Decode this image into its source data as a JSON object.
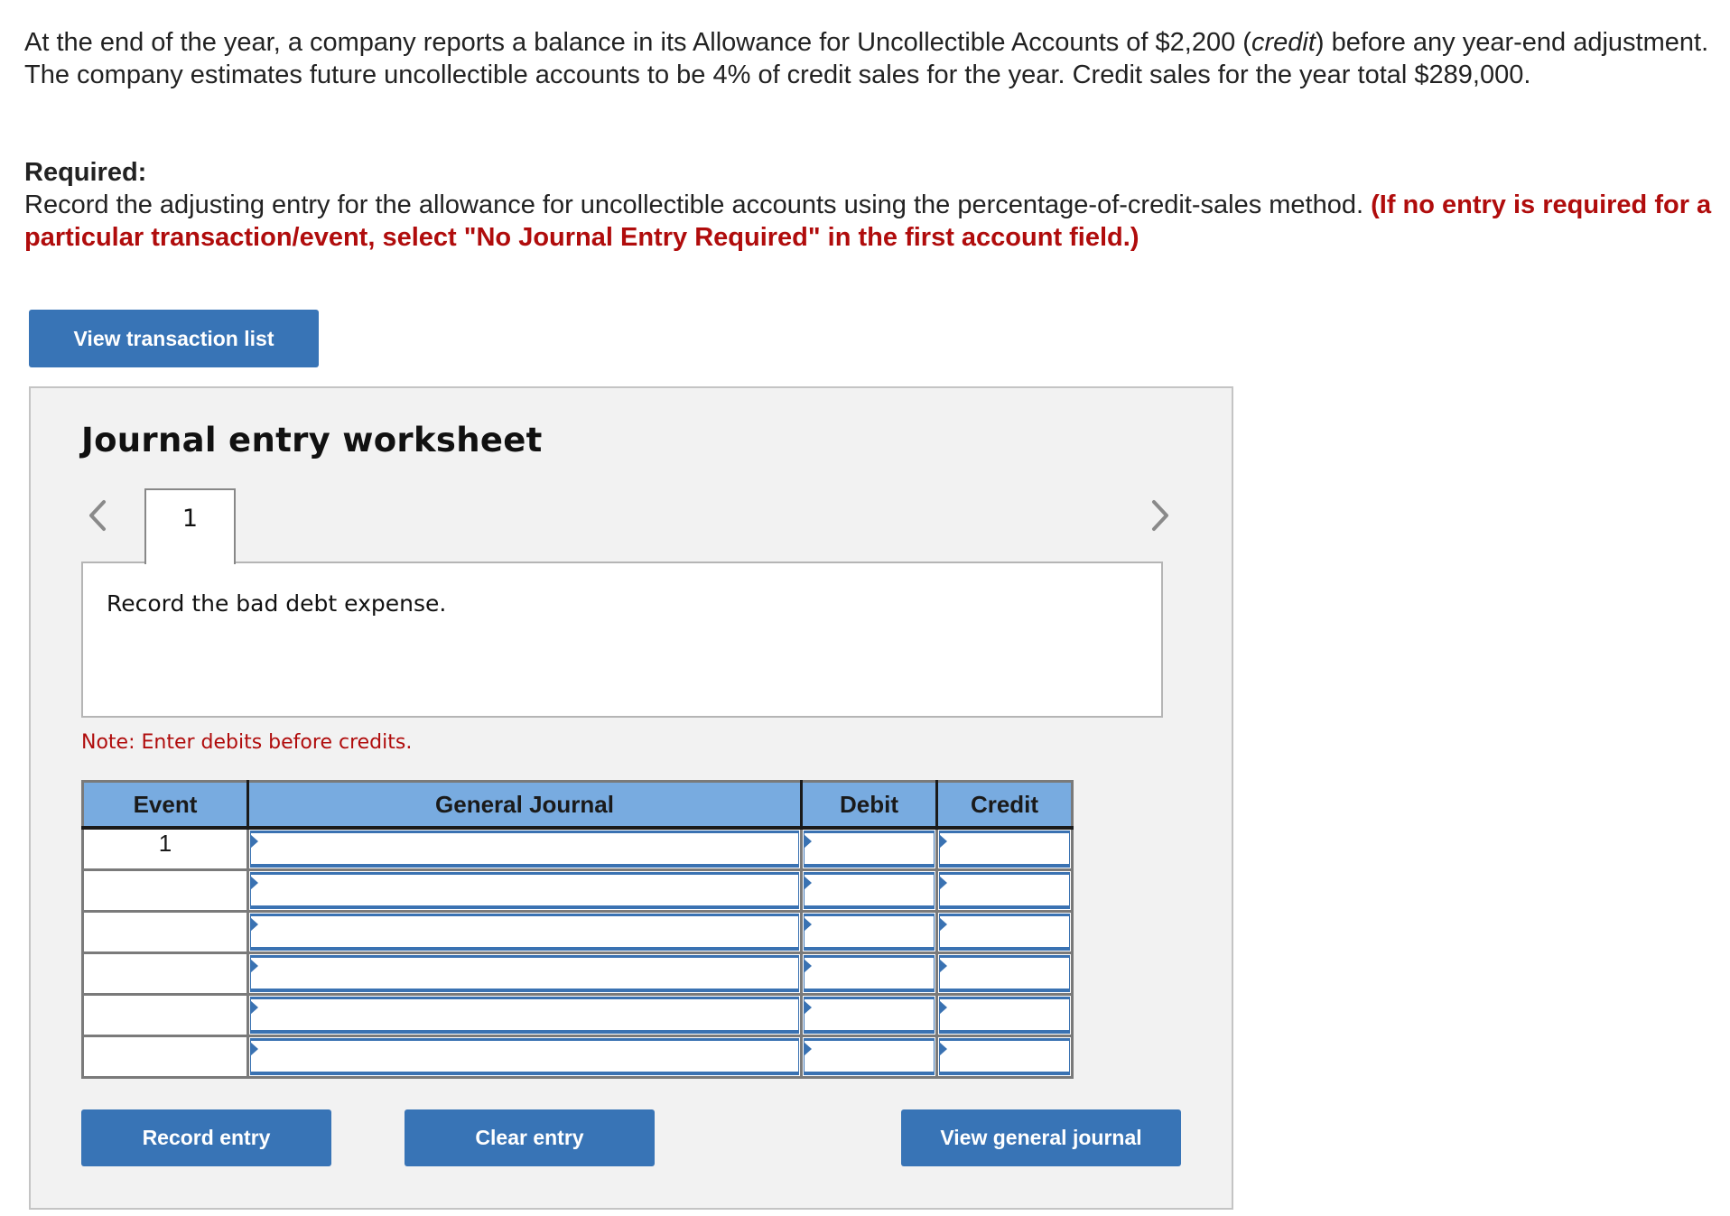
{
  "problem": {
    "part1": "At the end of the year, a company reports a balance in its Allowance for Uncollectible Accounts of $2,200 (",
    "italic": "credit",
    "part2": ") before any year-end adjustment. The company estimates future uncollectible accounts to be 4% of credit sales for the year. Credit sales for the year total $289,000."
  },
  "required": {
    "label": "Required:",
    "text": "Record the adjusting entry for the allowance for uncollectible accounts using the percentage-of-credit-sales method. ",
    "warning": "(If no entry is required for a particular transaction/event, select \"No Journal Entry Required\" in the first account field.)"
  },
  "buttons": {
    "view_transaction_list": "View transaction list",
    "record_entry": "Record entry",
    "clear_entry": "Clear entry",
    "view_general_journal": "View general journal"
  },
  "worksheet": {
    "title": "Journal entry worksheet",
    "tabs": [
      {
        "label": "1",
        "active": true
      }
    ],
    "instruction": "Record the bad debt expense.",
    "note": "Note: Enter debits before credits.",
    "nav": {
      "prev_icon": "chevron-left",
      "next_icon": "chevron-right"
    }
  },
  "journal": {
    "columns": [
      "Event",
      "General Journal",
      "Debit",
      "Credit"
    ],
    "rows": [
      {
        "event": "1",
        "account": "",
        "debit": "",
        "credit": ""
      },
      {
        "event": "",
        "account": "",
        "debit": "",
        "credit": ""
      },
      {
        "event": "",
        "account": "",
        "debit": "",
        "credit": ""
      },
      {
        "event": "",
        "account": "",
        "debit": "",
        "credit": ""
      },
      {
        "event": "",
        "account": "",
        "debit": "",
        "credit": ""
      },
      {
        "event": "",
        "account": "",
        "debit": "",
        "credit": ""
      }
    ]
  },
  "colors": {
    "button": "#3874B6",
    "header": "#78ABE0",
    "warning": "#B00C0C",
    "panel": "#F2F2F2"
  }
}
